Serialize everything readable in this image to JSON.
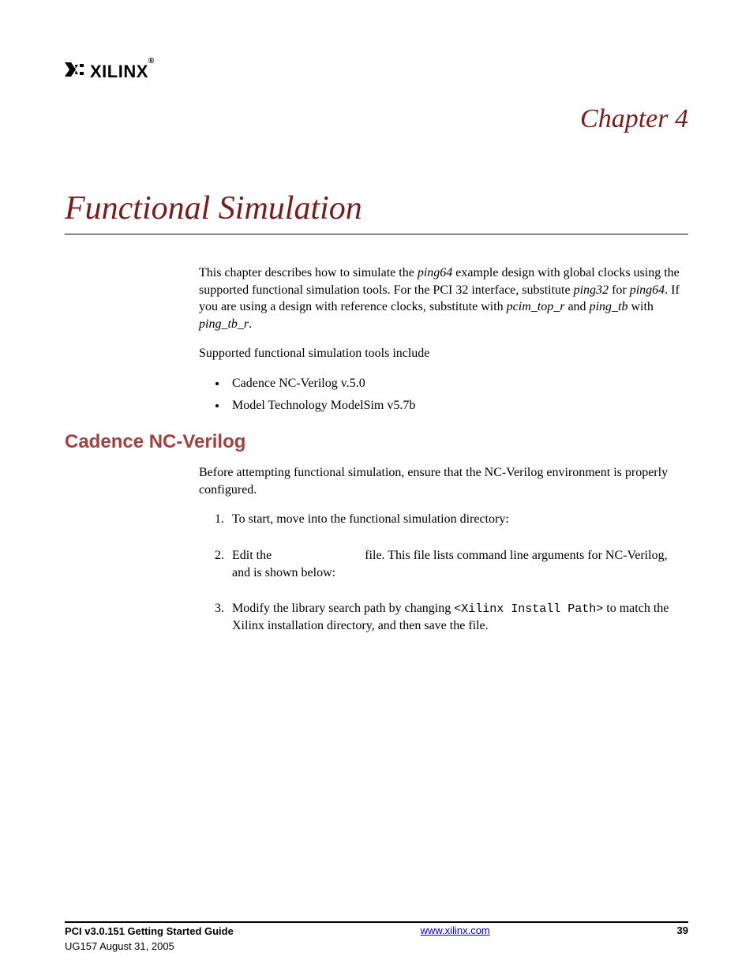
{
  "header": {
    "logo_text": "XILINX",
    "reg_mark": "®"
  },
  "chapter": {
    "label": "Chapter 4",
    "title": "Functional Simulation"
  },
  "intro": {
    "p1_a": "This chapter describes how to simulate the ",
    "p1_i1": "ping64",
    "p1_b": " example design with global clocks using the supported functional simulation tools. For the PCI 32 interface, substitute ",
    "p1_i2": "ping32",
    "p1_c": " for ",
    "p1_i3": "ping64",
    "p1_d": ". If you are using a design with reference clocks, substitute with ",
    "p1_i4": "pcim_top_r",
    "p1_e": " and ",
    "p1_i5": "ping_tb",
    "p1_f": " with ",
    "p1_i6": "ping_tb_r",
    "p1_g": ".",
    "p2": "Supported functional simulation tools include",
    "bullets": [
      "Cadence NC-Verilog v.5.0",
      "Model Technology ModelSim v5.7b"
    ]
  },
  "section1": {
    "heading": "Cadence NC-Verilog",
    "p1": "Before attempting functional simulation, ensure that the NC-Verilog environment is properly configured.",
    "steps": {
      "s1": "To start, move into the functional simulation directory:",
      "s2_a": "Edit the ",
      "s2_b": " file. This file lists command line arguments for NC-Verilog, and is shown below:",
      "s3_a": "Modify the library search path by changing ",
      "s3_code": "<Xilinx Install Path>",
      "s3_b": " to match the Xilinx installation directory, and then save the file."
    }
  },
  "footer": {
    "title": "PCI v3.0.151 Getting Started Guide",
    "sub": "UG157 August 31, 2005",
    "url": "www.xilinx.com",
    "page": "39"
  }
}
